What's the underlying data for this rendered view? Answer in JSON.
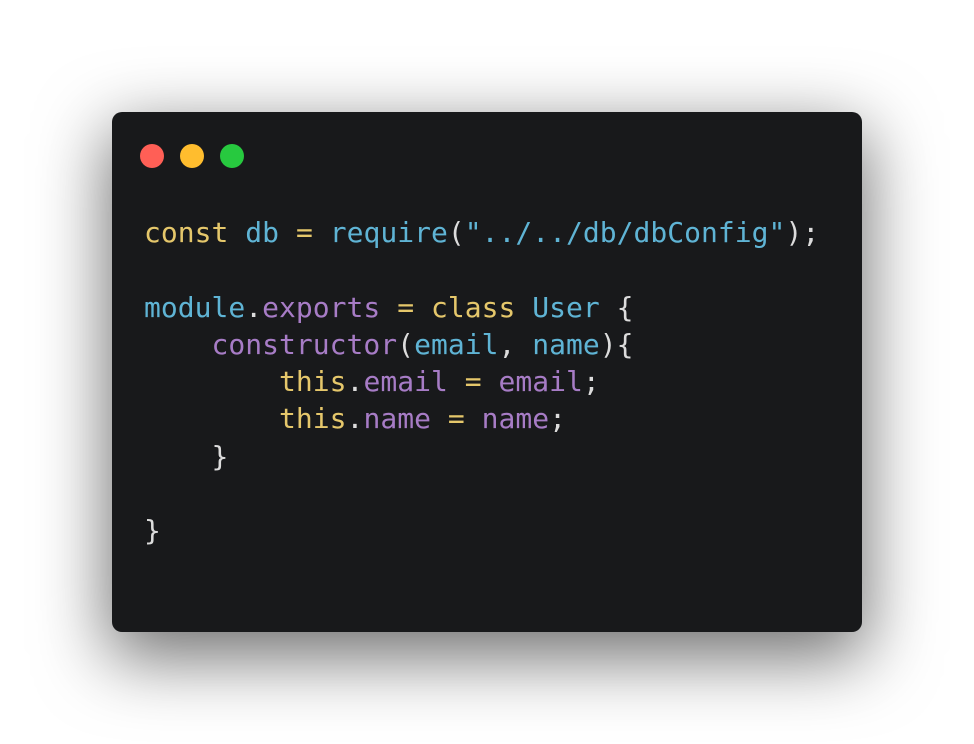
{
  "window": {
    "controls": [
      {
        "name": "close",
        "color": "#ff5f56"
      },
      {
        "name": "minimize",
        "color": "#ffbd2e"
      },
      {
        "name": "maximize",
        "color": "#27c93f"
      }
    ]
  },
  "code": {
    "line1": {
      "kw_const": "const",
      "id_db": "db",
      "op_eq": "=",
      "id_require": "require",
      "p_open": "(",
      "str_path": "\"../../db/dbConfig\"",
      "p_close_semi": ");"
    },
    "line3": {
      "id_module": "module",
      "dot": ".",
      "prop_exports": "exports",
      "op_eq": "=",
      "kw_class": "class",
      "id_user": "User",
      "brace_open": "{"
    },
    "line4": {
      "prop_constructor": "constructor",
      "p_open": "(",
      "id_email": "email",
      "comma": ",",
      "id_name": "name",
      "p_close_brace": "){"
    },
    "line5": {
      "kw_this": "this",
      "dot": ".",
      "prop_email": "email",
      "op_eq": "=",
      "prop_email_val": "email",
      "semi": ";"
    },
    "line6": {
      "kw_this": "this",
      "dot": ".",
      "prop_name": "name",
      "op_eq": "=",
      "prop_name_val": "name",
      "semi": ";"
    },
    "line7": {
      "brace_close": "}"
    },
    "line9": {
      "brace_close": "}"
    }
  }
}
